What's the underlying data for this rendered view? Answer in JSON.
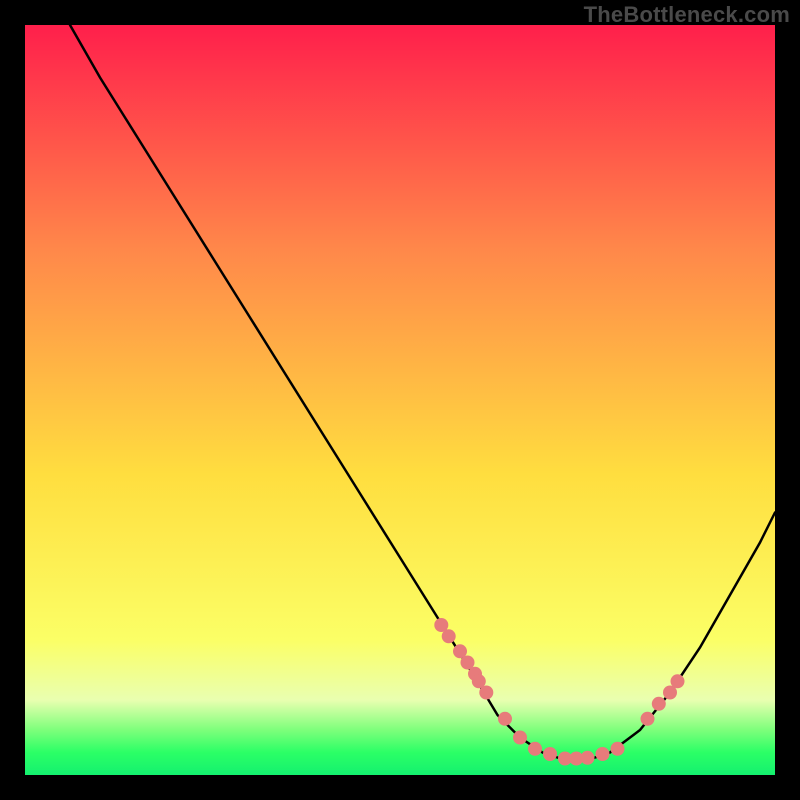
{
  "watermark": "TheBottleneck.com",
  "colors": {
    "top": "#ff1f4b",
    "mid_upper": "#ff884a",
    "mid": "#ffde3f",
    "lower_light": "#fbff66",
    "band_pale": "#e9ffb0",
    "band_green1": "#7dff7b",
    "band_green2": "#2bff66",
    "bottom": "#14f06f",
    "curve": "#000000",
    "dot": "#e77b7b"
  },
  "chart_data": {
    "type": "line",
    "title": "",
    "xlabel": "",
    "ylabel": "",
    "xlim": [
      0,
      100
    ],
    "ylim": [
      0,
      100
    ],
    "series": [
      {
        "name": "bottleneck-curve",
        "x": [
          6,
          10,
          15,
          20,
          25,
          30,
          35,
          40,
          45,
          50,
          55,
          60,
          63,
          66,
          69,
          72,
          75,
          78,
          82,
          86,
          90,
          94,
          98,
          100
        ],
        "y": [
          100,
          93,
          85,
          77,
          69,
          61,
          53,
          45,
          37,
          29,
          21,
          13,
          8,
          5,
          3,
          2,
          2,
          3,
          6,
          11,
          17,
          24,
          31,
          35
        ]
      }
    ],
    "scatter_points": {
      "name": "highlighted-points",
      "x": [
        55.5,
        56.5,
        58,
        59,
        60,
        60.5,
        61.5,
        64,
        66,
        68,
        70,
        72,
        73.5,
        75,
        77,
        79,
        83,
        84.5,
        86,
        87
      ],
      "y": [
        20,
        18.5,
        16.5,
        15,
        13.5,
        12.5,
        11,
        7.5,
        5,
        3.5,
        2.8,
        2.2,
        2.2,
        2.3,
        2.8,
        3.5,
        7.5,
        9.5,
        11,
        12.5
      ]
    }
  }
}
